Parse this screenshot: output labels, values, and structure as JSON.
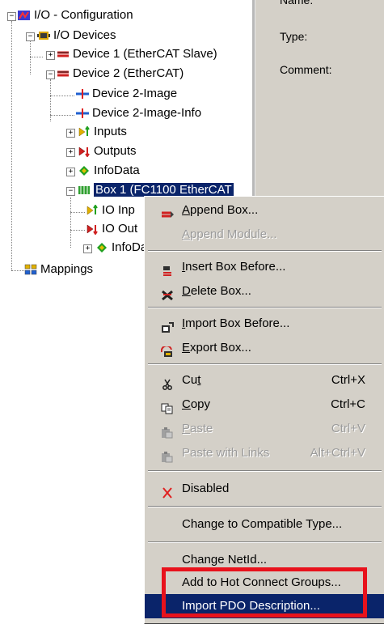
{
  "tree": {
    "root": "I/O - Configuration",
    "io_devices": "I/O Devices",
    "device1": "Device 1 (EtherCAT Slave)",
    "device2": "Device 2 (EtherCAT)",
    "device2_image": "Device 2-Image",
    "device2_image_info": "Device 2-Image-Info",
    "inputs": "Inputs",
    "outputs": "Outputs",
    "infodata": "InfoData",
    "box1": "Box 1 (FC1100 EtherCAT",
    "io_inputs": "IO Inp",
    "io_outputs": "IO Out",
    "box_infodata": "InfoDa",
    "mappings": "Mappings"
  },
  "properties": {
    "name_label": "Name:",
    "type_label": "Type:",
    "comment_label": "Comment:"
  },
  "context_menu": {
    "append_box": {
      "pre": "",
      "key": "A",
      "post": "ppend Box..."
    },
    "append_module": {
      "pre": "",
      "key": "A",
      "post": "ppend Module..."
    },
    "insert_box_before": {
      "pre": "",
      "key": "I",
      "post": "nsert Box Before..."
    },
    "delete_box": {
      "pre": "",
      "key": "D",
      "post": "elete Box..."
    },
    "import_box_before": {
      "pre": "",
      "key": "I",
      "post": "mport Box Before..."
    },
    "export_box": {
      "pre": "",
      "key": "E",
      "post": "xport Box..."
    },
    "cut": {
      "pre": "Cu",
      "key": "t",
      "post": "",
      "shortcut": "Ctrl+X"
    },
    "copy": {
      "pre": "",
      "key": "C",
      "post": "opy",
      "shortcut": "Ctrl+C"
    },
    "paste": {
      "pre": "",
      "key": "P",
      "post": "aste",
      "shortcut": "Ctrl+V"
    },
    "paste_with_links": {
      "label": "Paste with Links",
      "shortcut": "Alt+Ctrl+V"
    },
    "disabled": {
      "label": "Disabled"
    },
    "change_compatible": {
      "label": "Change to Compatible Type..."
    },
    "change_netid": {
      "label": "Change NetId..."
    },
    "add_hot_connect": {
      "label": "Add to Hot Connect Groups..."
    },
    "import_pdo": {
      "label": "Import PDO Description..."
    }
  },
  "colors": {
    "selection": "#0a246a",
    "menu_bg": "#d4d0c8",
    "highlight_box": "#e8121c"
  }
}
